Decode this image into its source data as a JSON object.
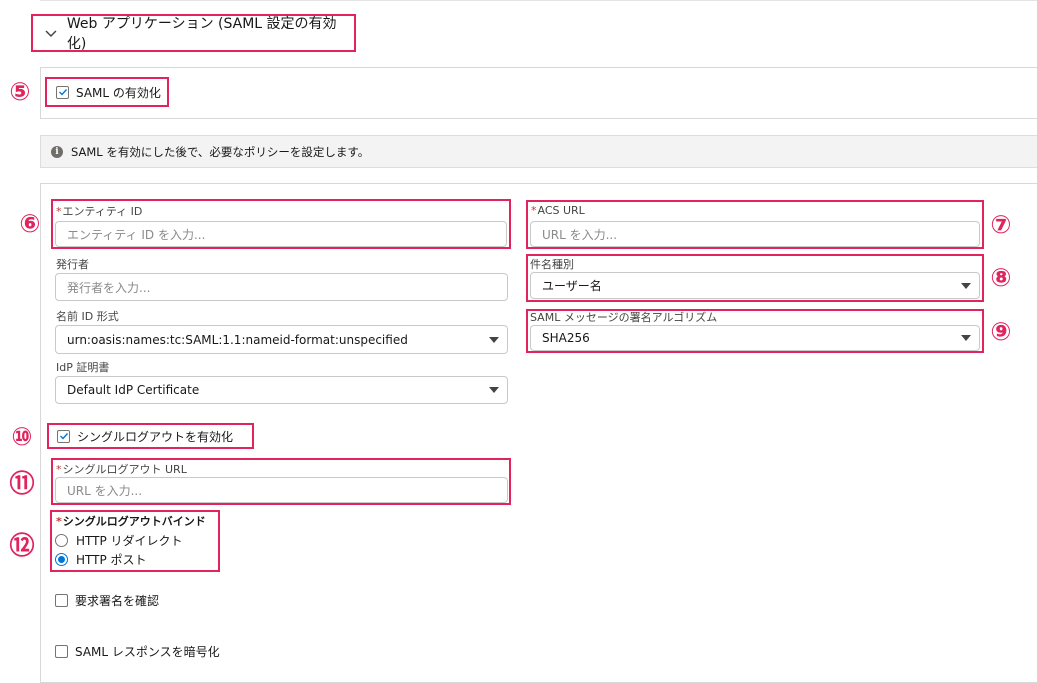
{
  "section": {
    "title": "Web アプリケーション (SAML 設定の有効化)"
  },
  "saml_enable": {
    "label": "SAML の有効化",
    "checked": true
  },
  "info": {
    "text": "SAML を有効にした後で、必要なポリシーを設定します。"
  },
  "form": {
    "entity_id": {
      "label": "エンティティ ID",
      "placeholder": "エンティティ ID を入力..."
    },
    "acs_url": {
      "label": "ACS URL",
      "placeholder": "URL を入力..."
    },
    "issuer": {
      "label": "発行者",
      "placeholder": "発行者を入力..."
    },
    "subject_type": {
      "label": "件名種別",
      "value": "ユーザー名"
    },
    "name_id_format": {
      "label": "名前 ID 形式",
      "value": "urn:oasis:names:tc:SAML:1.1:nameid-format:unspecified"
    },
    "signing_algorithm": {
      "label": "SAML メッセージの署名アルゴリズム",
      "value": "SHA256"
    },
    "idp_certificate": {
      "label": "IdP 証明書",
      "value": "Default IdP Certificate"
    },
    "single_logout": {
      "label": "シングルログアウトを有効化",
      "checked": true
    },
    "slo_url": {
      "label": "シングルログアウト URL",
      "placeholder": "URL を入力..."
    },
    "slo_binding": {
      "label": "シングルログアウトバインド",
      "options": [
        {
          "label": "HTTP リダイレクト",
          "selected": false
        },
        {
          "label": "HTTP ポスト",
          "selected": true
        }
      ]
    },
    "verify_request_signature": {
      "label": "要求署名を確認",
      "checked": false
    },
    "encrypt_saml_response": {
      "label": "SAML レスポンスを暗号化",
      "checked": false
    },
    "required_mark": "*"
  },
  "annotations": {
    "n5": "⑤",
    "n6": "⑥",
    "n7": "⑦",
    "n8": "⑧",
    "n9": "⑨",
    "n10": "⑩",
    "n11": "⑪",
    "n12": "⑫"
  },
  "colors": {
    "annotation": "#e0245e",
    "brand": "#0176d3"
  }
}
